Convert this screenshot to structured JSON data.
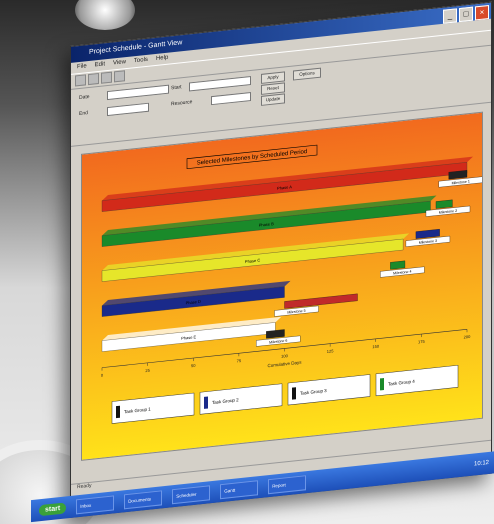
{
  "window": {
    "title": "Project Schedule - Gantt View",
    "menu": [
      "File",
      "Edit",
      "View",
      "Tools",
      "Help"
    ]
  },
  "form": {
    "label_a": "Date",
    "label_b": "Start",
    "label_c": "End",
    "label_d": "Resource",
    "button_apply": "Apply",
    "button_reset": "Reset",
    "button_update": "Update",
    "button_options": "Options",
    "field_1": "",
    "field_2": "",
    "field_3": ""
  },
  "chart_data": {
    "type": "bar",
    "title": "Selected Milestones by Scheduled Period",
    "x_axis_label": "Cumulative Days",
    "x_ticks": [
      "0",
      "25",
      "50",
      "75",
      "100",
      "125",
      "150",
      "175",
      "200"
    ],
    "bars": [
      {
        "label": "Phase A",
        "color": "#d22a1a",
        "start": 0,
        "end": 200
      },
      {
        "label": "Phase B",
        "color": "#1a8a2a",
        "start": 0,
        "end": 180
      },
      {
        "label": "Phase C",
        "color": "#e6e62a",
        "start": 0,
        "end": 165
      },
      {
        "label": "Phase D",
        "color": "#1a2a8a",
        "start": 0,
        "end": 100
      },
      {
        "label": "Phase E",
        "color": "#ffffff",
        "start": 0,
        "end": 95
      }
    ],
    "short_bars": [
      {
        "label": "Milestone 1",
        "color": "#222222",
        "start": 190,
        "end": 200
      },
      {
        "label": "Milestone 2",
        "color": "#1a8a2a",
        "start": 183,
        "end": 192
      },
      {
        "label": "Milestone 3",
        "color": "#1a2a8a",
        "start": 172,
        "end": 185
      },
      {
        "label": "Milestone 4",
        "color": "#1a8a2a",
        "start": 158,
        "end": 166
      },
      {
        "label": "Milestone 5",
        "color": "#c02a2a",
        "start": 100,
        "end": 140
      },
      {
        "label": "Milestone 6",
        "color": "#222222",
        "start": 90,
        "end": 100
      }
    ],
    "legend": [
      {
        "color": "#111111",
        "label": "Task Group 1"
      },
      {
        "color": "#1a2a8a",
        "label": "Task Group 2"
      },
      {
        "color": "#111111",
        "label": "Task Group 3"
      },
      {
        "color": "#1a8a2a",
        "label": "Task Group 4"
      }
    ],
    "legend_placement": "bottom",
    "grid": false
  },
  "taskbar": {
    "start": "start",
    "tasks": [
      "Inbox",
      "Documents",
      "Scheduler",
      "Gantt",
      "Report"
    ],
    "clock": "10:12"
  },
  "status": {
    "text": "Ready"
  },
  "colors": {
    "chart_bg_top": "#f26a1e",
    "chart_bg_bottom": "#ffe21a",
    "taskbar": "#245edb"
  }
}
